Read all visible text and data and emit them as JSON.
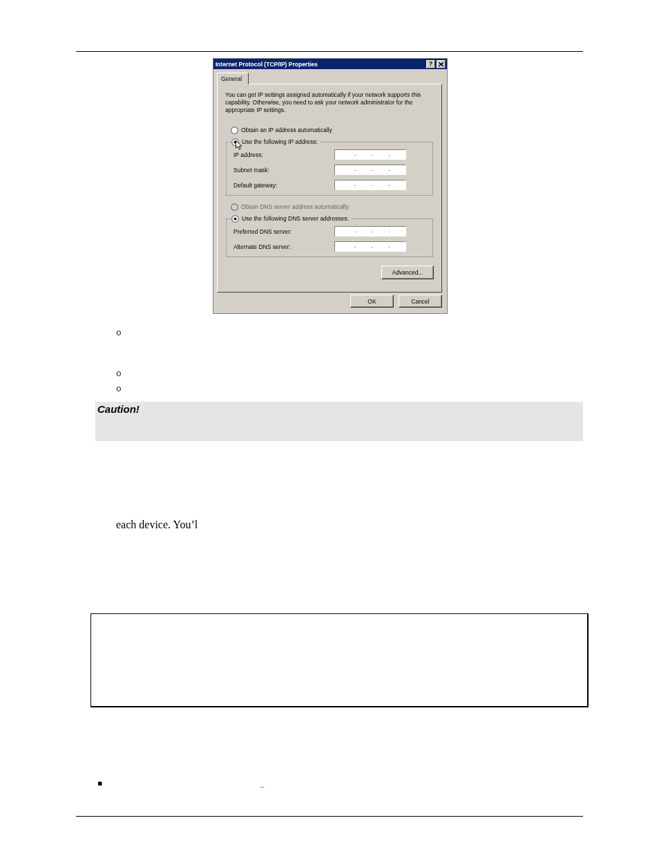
{
  "dialog": {
    "title": "Internet Protocol (TCP/IP) Properties",
    "title_buttons": [
      {
        "kind": "help",
        "label": "?"
      },
      {
        "kind": "close"
      }
    ],
    "tabs": [
      {
        "label": "General",
        "selected": true
      }
    ],
    "intro": "You can get IP settings assigned automatically if your network supports this capability. Otherwise, you need to ask your network administrator for the appropriate IP settings.",
    "ip_section": {
      "auto_option": {
        "label": "Obtain an IP address automatically",
        "selected": false,
        "disabled": false
      },
      "manual_option": {
        "label": "Use the following IP address:",
        "selected": true,
        "disabled": false
      },
      "fields": [
        {
          "label": "IP address:",
          "value": ". . ."
        },
        {
          "label": "Subnet mask:",
          "value": ". . ."
        },
        {
          "label": "Default gateway:",
          "value": ". . ."
        }
      ]
    },
    "dns_section": {
      "auto_option": {
        "label": "Obtain DNS server address automatically",
        "selected": false,
        "disabled": true
      },
      "manual_option": {
        "label": "Use the following DNS server addresses:",
        "selected": true,
        "disabled": false
      },
      "fields": [
        {
          "label": "Preferred DNS server:",
          "value": ". . ."
        },
        {
          "label": "Alternate DNS server:",
          "value": ". . ."
        }
      ]
    },
    "advanced_button": "Advanced...",
    "footer_buttons": [
      {
        "label": "OK"
      },
      {
        "label": "Cancel"
      }
    ]
  },
  "sub_bullets": [
    {
      "marker": "o"
    },
    {
      "marker": "o"
    },
    {
      "marker": "o"
    }
  ],
  "caution": {
    "title": "Caution!"
  },
  "body_text": "each device. You’l",
  "bottom_bullets": [
    {
      "marker": "▪",
      "text": "_"
    }
  ]
}
